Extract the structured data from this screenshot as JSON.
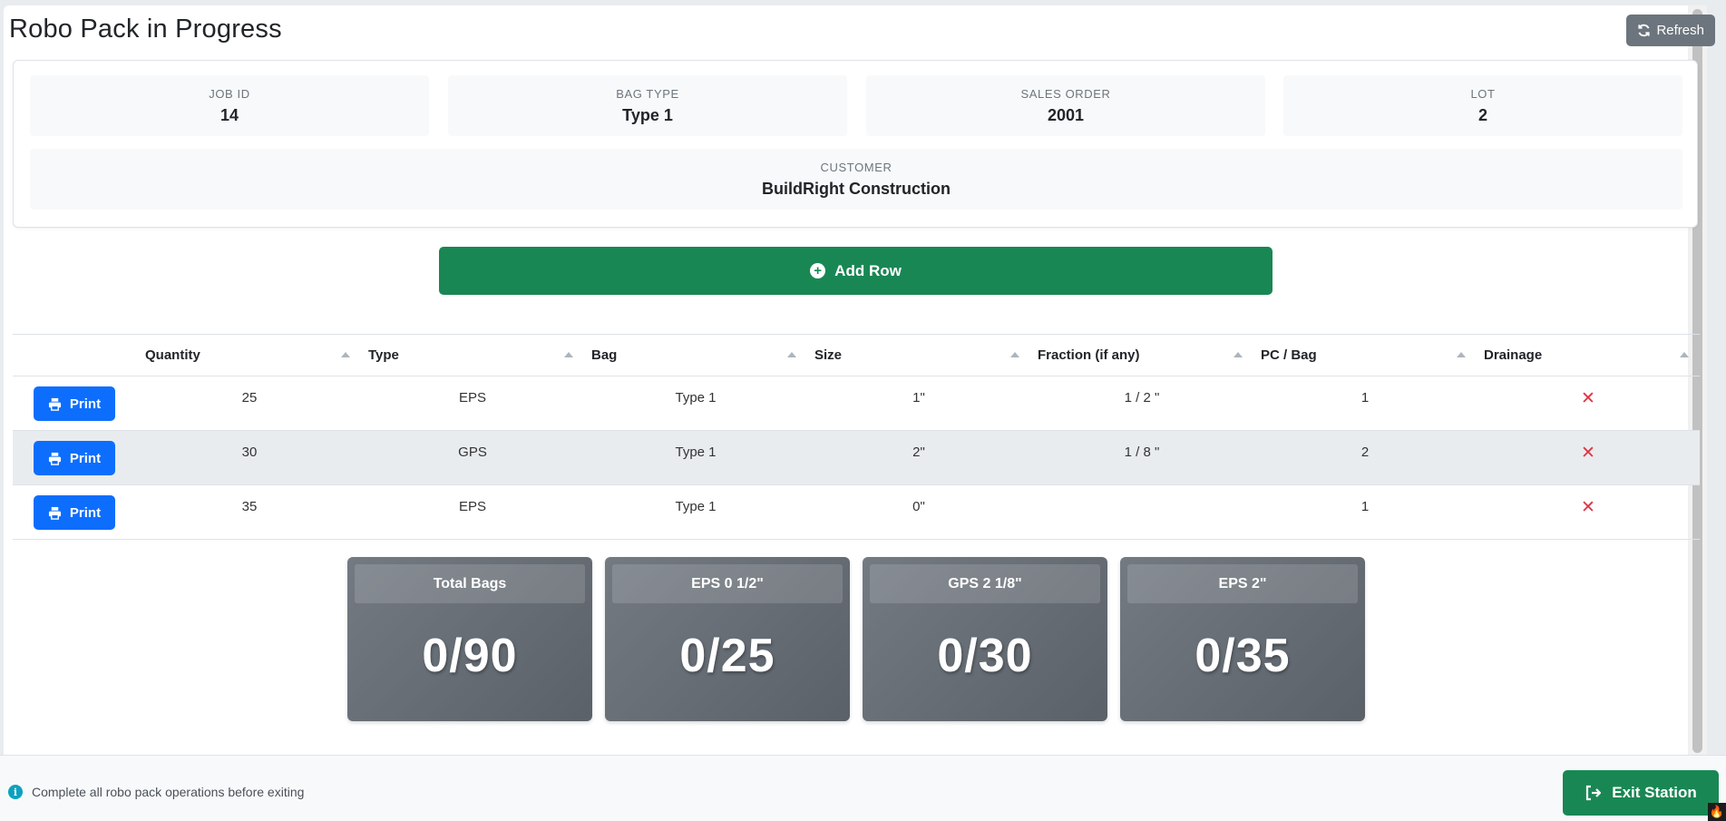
{
  "header": {
    "title": "Robo Pack in Progress",
    "refresh_label": "Refresh"
  },
  "job_info": {
    "job_id": {
      "label": "JOB ID",
      "value": "14"
    },
    "bag_type": {
      "label": "BAG TYPE",
      "value": "Type 1"
    },
    "sales_order": {
      "label": "SALES ORDER",
      "value": "2001"
    },
    "lot": {
      "label": "LOT",
      "value": "2"
    },
    "customer": {
      "label": "CUSTOMER",
      "value": "BuildRight Construction"
    }
  },
  "add_row_label": "Add Row",
  "table": {
    "columns": [
      "Quantity",
      "Type",
      "Bag",
      "Size",
      "Fraction (if any)",
      "PC / Bag",
      "Drainage"
    ],
    "print_label": "Print",
    "rows": [
      {
        "quantity": "25",
        "type": "EPS",
        "bag": "Type 1",
        "size": "1\"",
        "fraction": "1 / 2 \"",
        "pc_bag": "1",
        "drainage": "✕"
      },
      {
        "quantity": "30",
        "type": "GPS",
        "bag": "Type 1",
        "size": "2\"",
        "fraction": "1 / 8 \"",
        "pc_bag": "2",
        "drainage": "✕"
      },
      {
        "quantity": "35",
        "type": "EPS",
        "bag": "Type 1",
        "size": "0\"",
        "fraction": "",
        "pc_bag": "1",
        "drainage": "✕"
      }
    ]
  },
  "stats": [
    {
      "title": "Total Bags",
      "value": "0/90"
    },
    {
      "title": "EPS 0 1/2\"",
      "value": "0/25"
    },
    {
      "title": "GPS 2 1/8\"",
      "value": "0/30"
    },
    {
      "title": "EPS 2\"",
      "value": "0/35"
    }
  ],
  "footer": {
    "message": "Complete all robo pack operations before exiting",
    "exit_label": "Exit Station"
  },
  "colors": {
    "primary": "#0d6efd",
    "success": "#198754",
    "secondary": "#6c757d",
    "danger": "#dc3545",
    "info": "#0aa2c0"
  },
  "icons": [
    "refresh-icon",
    "plus-circle-icon",
    "printer-icon",
    "x-icon",
    "info-icon",
    "exit-icon",
    "fire-icon"
  ]
}
